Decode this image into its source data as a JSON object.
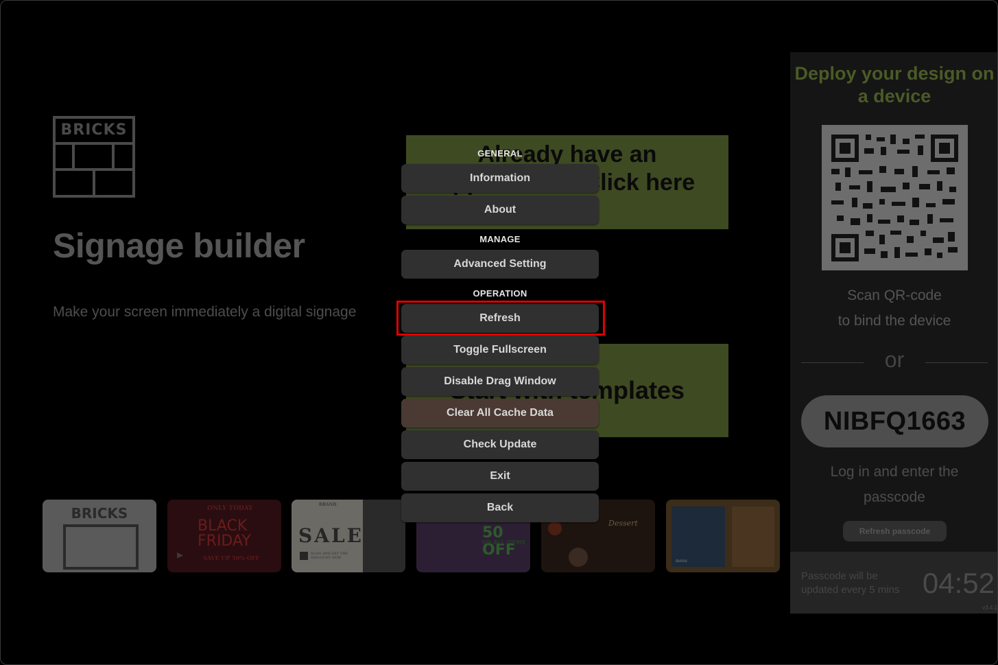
{
  "app": {
    "logo_text": "BRICKS",
    "title": "Signage builder",
    "subtitle": "Make your screen immediately a digital signage"
  },
  "cards": {
    "existing": "Already have an application? Click here",
    "templates": "Start with templates"
  },
  "thumbnails": [
    {
      "label": "BRICKS"
    },
    {
      "label": "BLACK FRIDAY",
      "small": "ONLY TODAY",
      "footer": "SAVE UP 50% OFF"
    },
    {
      "label": "SALE",
      "small": "BRAND",
      "footer": "SCAN AND GET THE DISCOUNT NOW"
    },
    {
      "label": "50 OFF",
      "small": "ON ALL ITEMS"
    },
    {
      "label": "Dessert"
    },
    {
      "label": "menu"
    }
  ],
  "panel": {
    "deploy_title": "Deploy your design on a device",
    "scan_line1": "Scan QR-code",
    "scan_line2": "to bind the device",
    "or": "or",
    "passcode": "NIBFQ1663",
    "login_line1": "Log in and enter the",
    "login_line2": "passcode",
    "refresh_passcode": "Refresh passcode",
    "footer_note_line1": "Passcode will be",
    "footer_note_line2": "updated every 5 mins",
    "countdown": "04:52",
    "version": "v3.4.1"
  },
  "menu": {
    "general_heading": "GENERAL",
    "information": "Information",
    "about": "About",
    "manage_heading": "MANAGE",
    "advanced_setting": "Advanced Setting",
    "operation_heading": "OPERATION",
    "refresh": "Refresh",
    "toggle_fullscreen": "Toggle Fullscreen",
    "disable_drag_window": "Disable Drag Window",
    "clear_cache": "Clear All Cache Data",
    "check_update": "Check Update",
    "exit": "Exit",
    "back": "Back"
  },
  "colors": {
    "highlight": "#e00000",
    "accent_green": "#4b5a28"
  }
}
